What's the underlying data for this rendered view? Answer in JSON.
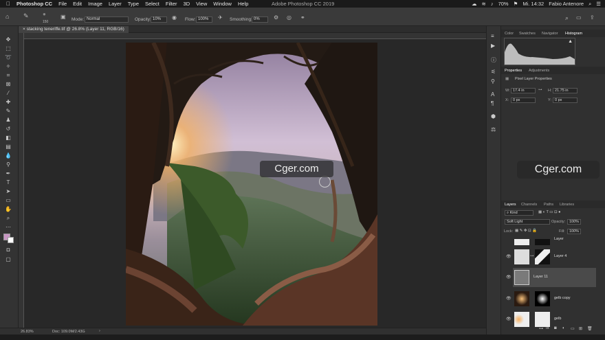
{
  "menubar": {
    "app": "Photoshop CC",
    "items": [
      "File",
      "Edit",
      "Image",
      "Layer",
      "Type",
      "Select",
      "Filter",
      "3D",
      "View",
      "Window",
      "Help"
    ],
    "title": "Adobe Photoshop CC 2019",
    "battery": "70%",
    "clock": "Mi. 14:32",
    "user": "Fabio Antenore"
  },
  "options": {
    "brush_size": "150",
    "mode_label": "Mode:",
    "mode_value": "Normal",
    "opacity_label": "Opacity:",
    "opacity_value": "10%",
    "flow_label": "Flow:",
    "flow_value": "100%",
    "smoothing_label": "Smoothing:",
    "smoothing_value": "0%"
  },
  "document": {
    "tab": "stacking teneriffe.tif @ 26.8% (Layer 11, RGB/16)",
    "zoom": "26.83%",
    "doc_info": "Doc: 109.0M/2.43G"
  },
  "watermarks": [
    "Cger.com",
    "Cger.com"
  ],
  "panels": {
    "top_tabs": [
      "Color",
      "Swatches",
      "Navigator",
      "Histogram"
    ],
    "prop_tabs": [
      "Properties",
      "Adjustments"
    ],
    "prop_title": "Pixel Layer Properties",
    "w_label": "W:",
    "w_value": "17.4 in",
    "h_label": "H:",
    "h_value": "21.75 in",
    "x_label": "X:",
    "x_value": "0 px",
    "y_label": "Y:",
    "y_value": "0 px",
    "layer_tabs": [
      "Layers",
      "Channels",
      "Paths",
      "Libraries"
    ],
    "kind": "Kind",
    "blend_mode": "Soft Light",
    "opacity_label": "Opacity:",
    "opacity_value": "100%",
    "lock_label": "Lock:",
    "fill_label": "Fill:",
    "fill_value": "100%",
    "layers": [
      {
        "name": "Layer"
      },
      {
        "name": "Layer 4"
      },
      {
        "name": "Layer 11"
      },
      {
        "name": "gelb copy"
      },
      {
        "name": "gelb"
      }
    ]
  }
}
